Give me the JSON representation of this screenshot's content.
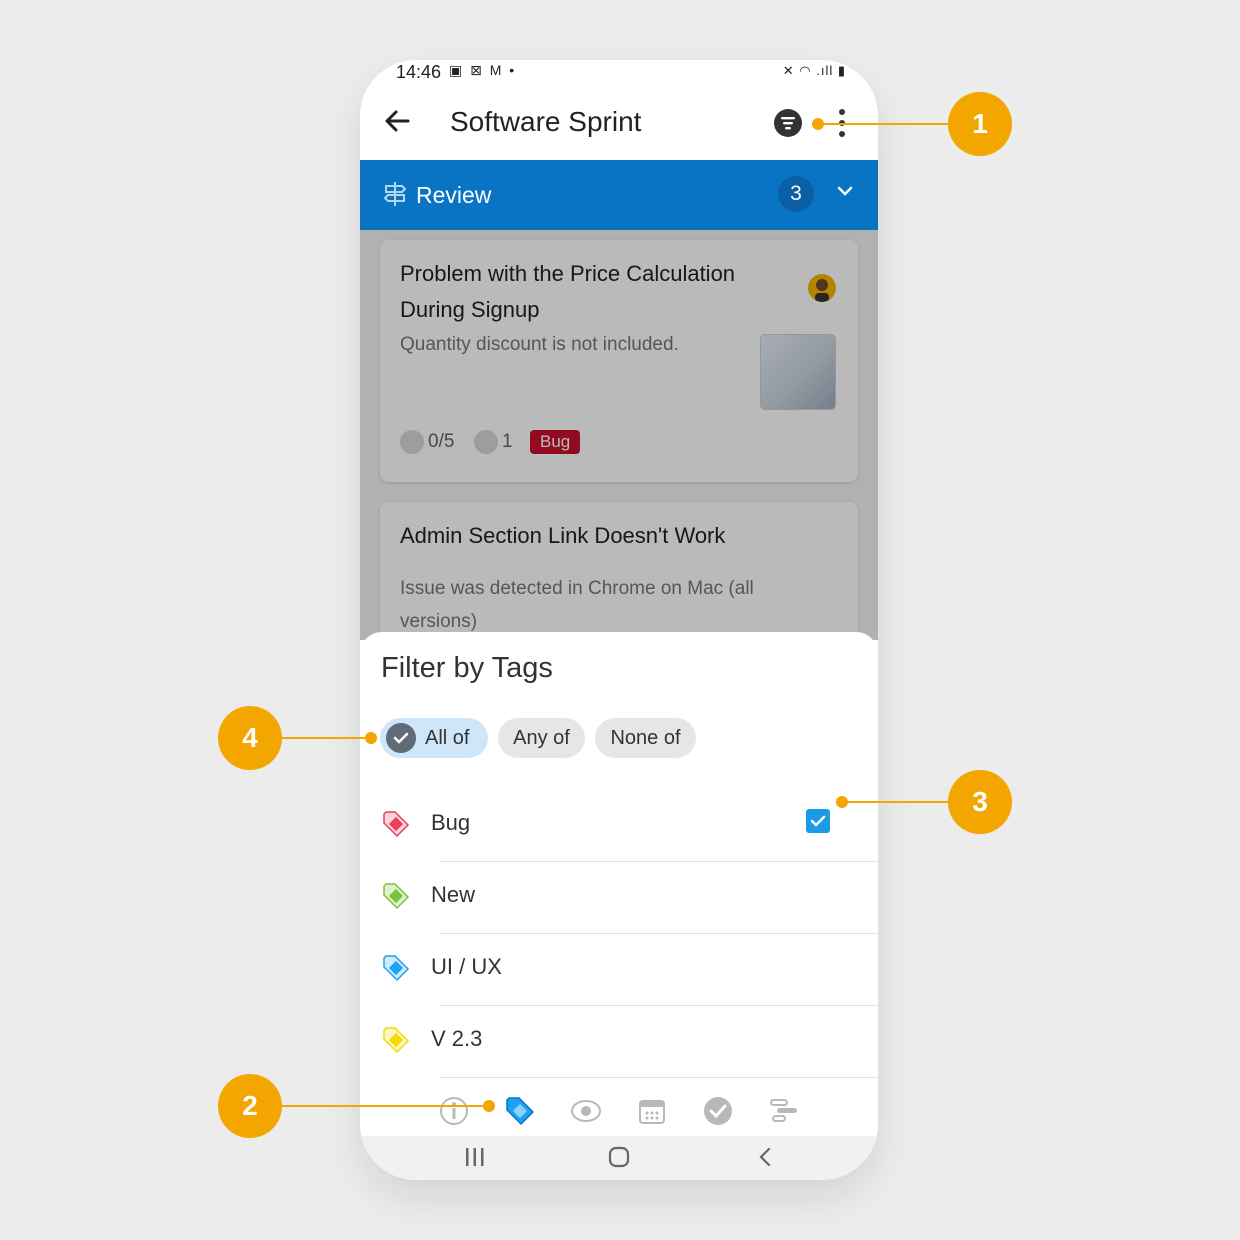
{
  "status_bar": {
    "time": "14:46",
    "left_icons": "▣ ⊠ M •",
    "right_icons": "✕ ◠ .ıll ▮"
  },
  "app_bar": {
    "title": "Software Sprint"
  },
  "column": {
    "name": "Review",
    "count": "3"
  },
  "cards": [
    {
      "title": "Problem with the Price Calculation During Signup",
      "description": "Quantity discount is not included.",
      "checklist": "0/5",
      "attachments": "1",
      "tag": "Bug"
    },
    {
      "title": "Admin Section Link Doesn't Work",
      "description": "Issue was detected in Chrome on Mac (all versions)"
    }
  ],
  "sheet": {
    "title": "Filter by Tags",
    "modes": [
      {
        "label": "All of",
        "selected": true
      },
      {
        "label": "Any of",
        "selected": false
      },
      {
        "label": "None of",
        "selected": false
      }
    ],
    "tags": [
      {
        "label": "Bug",
        "color": "#e8405b",
        "checked": true
      },
      {
        "label": "New",
        "color": "#7cc242",
        "checked": false
      },
      {
        "label": "UI / UX",
        "color": "#1da1f2",
        "checked": false
      },
      {
        "label": "V 2.3",
        "color": "#f7d800",
        "checked": false
      }
    ],
    "bottom_tabs": [
      "info-icon",
      "tag-icon",
      "eye-icon",
      "calendar-icon",
      "check-circle-icon",
      "gantt-icon"
    ]
  },
  "colors": {
    "accent": "#0a74c4",
    "callout": "#f4a600"
  },
  "callouts": [
    "1",
    "2",
    "3",
    "4"
  ]
}
